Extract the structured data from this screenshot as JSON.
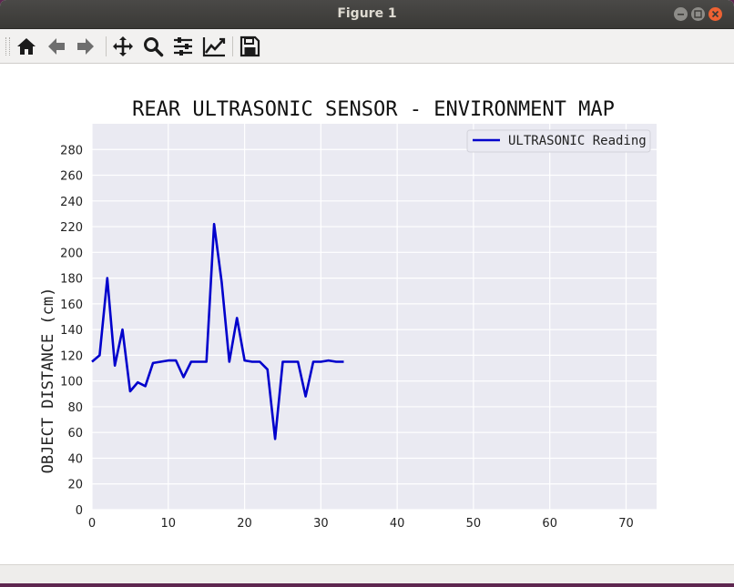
{
  "window": {
    "title": "Figure 1"
  },
  "toolbar": {
    "buttons": [
      "home-icon",
      "back-arrow-icon",
      "forward-arrow-icon",
      "pan-icon",
      "zoom-icon",
      "configure-subplots-icon",
      "edit-axis-icon",
      "save-icon"
    ]
  },
  "colors": {
    "plot_bg": "#eaeaf2",
    "line": "#0000cc",
    "titlebar": "#3c3b37",
    "close": "#ed6233"
  },
  "chart_data": {
    "type": "line",
    "title": "REAR ULTRASONIC SENSOR - ENVIRONMENT MAP",
    "xlabel": "",
    "ylabel": "OBJECT DISTANCE (cm)",
    "xlim": [
      0,
      74
    ],
    "ylim": [
      0,
      300
    ],
    "xticks": [
      0,
      10,
      20,
      30,
      40,
      50,
      60,
      70
    ],
    "yticks": [
      0,
      20,
      40,
      60,
      80,
      100,
      120,
      140,
      160,
      180,
      200,
      220,
      240,
      260,
      280
    ],
    "grid": true,
    "legend_position": "top-right",
    "series": [
      {
        "name": "ULTRASONIC Reading",
        "color": "#0000cc",
        "x": [
          0,
          1,
          2,
          3,
          4,
          5,
          6,
          7,
          8,
          9,
          10,
          11,
          12,
          13,
          14,
          15,
          16,
          17,
          18,
          19,
          20,
          21,
          22,
          23,
          24,
          25,
          26,
          27,
          28,
          29,
          30,
          31,
          32,
          33
        ],
        "y": [
          115,
          120,
          180,
          112,
          140,
          92,
          99,
          96,
          114,
          115,
          116,
          116,
          103,
          115,
          115,
          115,
          222,
          177,
          115,
          149,
          116,
          115,
          115,
          109,
          55,
          115,
          115,
          115,
          88,
          115,
          115,
          116,
          115,
          115
        ]
      }
    ]
  }
}
